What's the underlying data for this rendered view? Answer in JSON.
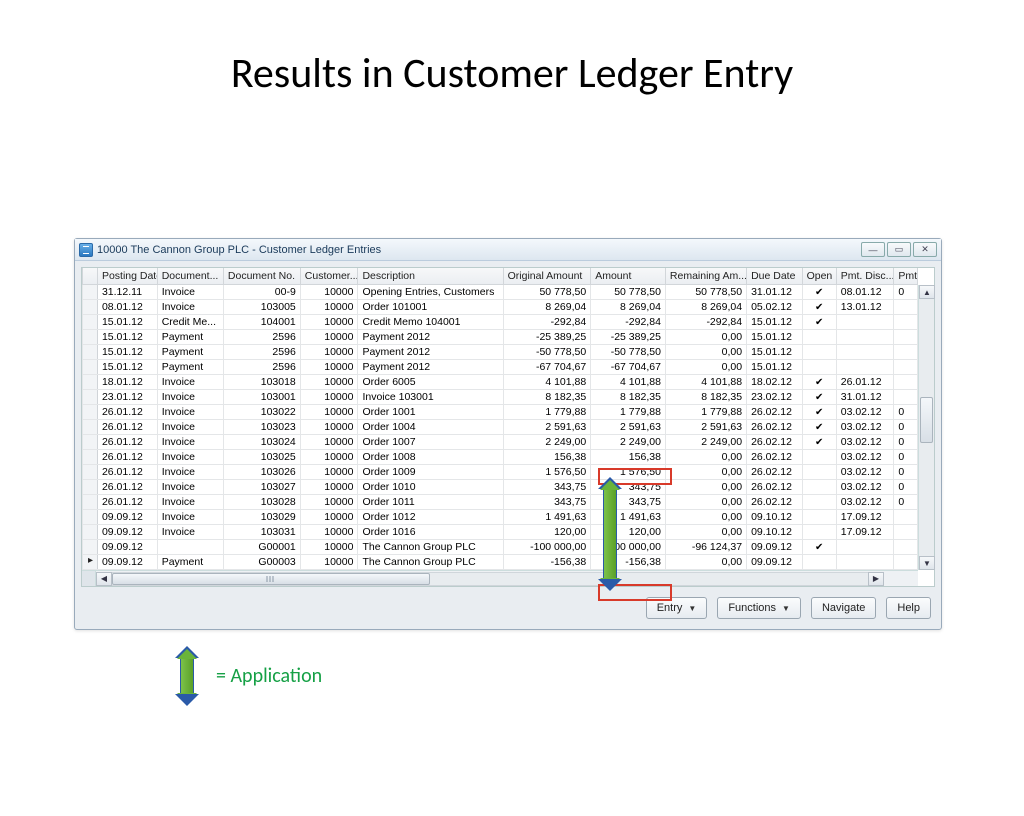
{
  "slide_title": "Results in Customer Ledger Entry",
  "window_title": "10000 The Cannon Group PLC - Customer Ledger Entries",
  "legend_label": "= Application",
  "buttons": {
    "entry": "Entry",
    "functions": "Functions",
    "navigate": "Navigate",
    "help": "Help"
  },
  "columns": [
    "",
    "Posting Date",
    "Document...",
    "Document No.",
    "Customer...",
    "Description",
    "Original Amount",
    "Amount",
    "Remaining Am...",
    "Due Date",
    "Open",
    "Pmt. Disc...",
    "Pmt"
  ],
  "rows": [
    {
      "ind": "",
      "post": "31.12.11",
      "doc": "Invoice",
      "docno": "00-9",
      "cust": "10000",
      "desc": "Opening Entries, Customers",
      "orig": "50 778,50",
      "amt": "50 778,50",
      "rem": "50 778,50",
      "due": "31.01.12",
      "open": true,
      "pdisc": "08.01.12",
      "pmt": "0"
    },
    {
      "ind": "",
      "post": "08.01.12",
      "doc": "Invoice",
      "docno": "103005",
      "cust": "10000",
      "desc": "Order 101001",
      "orig": "8 269,04",
      "amt": "8 269,04",
      "rem": "8 269,04",
      "due": "05.02.12",
      "open": true,
      "pdisc": "13.01.12",
      "pmt": ""
    },
    {
      "ind": "",
      "post": "15.01.12",
      "doc": "Credit Me...",
      "docno": "104001",
      "cust": "10000",
      "desc": "Credit Memo 104001",
      "orig": "-292,84",
      "amt": "-292,84",
      "rem": "-292,84",
      "due": "15.01.12",
      "open": true,
      "pdisc": "",
      "pmt": ""
    },
    {
      "ind": "",
      "post": "15.01.12",
      "doc": "Payment",
      "docno": "2596",
      "cust": "10000",
      "desc": "Payment 2012",
      "orig": "-25 389,25",
      "amt": "-25 389,25",
      "rem": "0,00",
      "due": "15.01.12",
      "open": false,
      "pdisc": "",
      "pmt": ""
    },
    {
      "ind": "",
      "post": "15.01.12",
      "doc": "Payment",
      "docno": "2596",
      "cust": "10000",
      "desc": "Payment 2012",
      "orig": "-50 778,50",
      "amt": "-50 778,50",
      "rem": "0,00",
      "due": "15.01.12",
      "open": false,
      "pdisc": "",
      "pmt": ""
    },
    {
      "ind": "",
      "post": "15.01.12",
      "doc": "Payment",
      "docno": "2596",
      "cust": "10000",
      "desc": "Payment 2012",
      "orig": "-67 704,67",
      "amt": "-67 704,67",
      "rem": "0,00",
      "due": "15.01.12",
      "open": false,
      "pdisc": "",
      "pmt": ""
    },
    {
      "ind": "",
      "post": "18.01.12",
      "doc": "Invoice",
      "docno": "103018",
      "cust": "10000",
      "desc": "Order 6005",
      "orig": "4 101,88",
      "amt": "4 101,88",
      "rem": "4 101,88",
      "due": "18.02.12",
      "open": true,
      "pdisc": "26.01.12",
      "pmt": ""
    },
    {
      "ind": "",
      "post": "23.01.12",
      "doc": "Invoice",
      "docno": "103001",
      "cust": "10000",
      "desc": "Invoice 103001",
      "orig": "8 182,35",
      "amt": "8 182,35",
      "rem": "8 182,35",
      "due": "23.02.12",
      "open": true,
      "pdisc": "31.01.12",
      "pmt": ""
    },
    {
      "ind": "",
      "post": "26.01.12",
      "doc": "Invoice",
      "docno": "103022",
      "cust": "10000",
      "desc": "Order 1001",
      "orig": "1 779,88",
      "amt": "1 779,88",
      "rem": "1 779,88",
      "due": "26.02.12",
      "open": true,
      "pdisc": "03.02.12",
      "pmt": "0"
    },
    {
      "ind": "",
      "post": "26.01.12",
      "doc": "Invoice",
      "docno": "103023",
      "cust": "10000",
      "desc": "Order 1004",
      "orig": "2 591,63",
      "amt": "2 591,63",
      "rem": "2 591,63",
      "due": "26.02.12",
      "open": true,
      "pdisc": "03.02.12",
      "pmt": "0"
    },
    {
      "ind": "",
      "post": "26.01.12",
      "doc": "Invoice",
      "docno": "103024",
      "cust": "10000",
      "desc": "Order 1007",
      "orig": "2 249,00",
      "amt": "2 249,00",
      "rem": "2 249,00",
      "due": "26.02.12",
      "open": true,
      "pdisc": "03.02.12",
      "pmt": "0"
    },
    {
      "ind": "",
      "post": "26.01.12",
      "doc": "Invoice",
      "docno": "103025",
      "cust": "10000",
      "desc": "Order 1008",
      "orig": "156,38",
      "amt": "156,38",
      "rem": "0,00",
      "due": "26.02.12",
      "open": false,
      "pdisc": "03.02.12",
      "pmt": "0"
    },
    {
      "ind": "",
      "post": "26.01.12",
      "doc": "Invoice",
      "docno": "103026",
      "cust": "10000",
      "desc": "Order 1009",
      "orig": "1 576,50",
      "amt": "1 576,50",
      "rem": "0,00",
      "due": "26.02.12",
      "open": false,
      "pdisc": "03.02.12",
      "pmt": "0"
    },
    {
      "ind": "",
      "post": "26.01.12",
      "doc": "Invoice",
      "docno": "103027",
      "cust": "10000",
      "desc": "Order 1010",
      "orig": "343,75",
      "amt": "343,75",
      "rem": "0,00",
      "due": "26.02.12",
      "open": false,
      "pdisc": "03.02.12",
      "pmt": "0"
    },
    {
      "ind": "",
      "post": "26.01.12",
      "doc": "Invoice",
      "docno": "103028",
      "cust": "10000",
      "desc": "Order 1011",
      "orig": "343,75",
      "amt": "343,75",
      "rem": "0,00",
      "due": "26.02.12",
      "open": false,
      "pdisc": "03.02.12",
      "pmt": "0"
    },
    {
      "ind": "",
      "post": "09.09.12",
      "doc": "Invoice",
      "docno": "103029",
      "cust": "10000",
      "desc": "Order 1012",
      "orig": "1 491,63",
      "amt": "1 491,63",
      "rem": "0,00",
      "due": "09.10.12",
      "open": false,
      "pdisc": "17.09.12",
      "pmt": ""
    },
    {
      "ind": "",
      "post": "09.09.12",
      "doc": "Invoice",
      "docno": "103031",
      "cust": "10000",
      "desc": "Order 1016",
      "orig": "120,00",
      "amt": "120,00",
      "rem": "0,00",
      "due": "09.10.12",
      "open": false,
      "pdisc": "17.09.12",
      "pmt": ""
    },
    {
      "ind": "",
      "post": "09.09.12",
      "doc": "",
      "docno": "G00001",
      "cust": "10000",
      "desc": "The Cannon Group PLC",
      "orig": "-100 000,00",
      "amt": "-100 000,00",
      "rem": "-96 124,37",
      "due": "09.09.12",
      "open": true,
      "pdisc": "",
      "pmt": ""
    },
    {
      "ind": "active",
      "post": "09.09.12",
      "doc": "Payment",
      "docno": "G00003",
      "cust": "10000",
      "desc": "The Cannon Group PLC",
      "orig": "-156,38",
      "amt": "-156,38",
      "rem": "0,00",
      "due": "09.09.12",
      "open": false,
      "pdisc": "",
      "pmt": ""
    }
  ]
}
